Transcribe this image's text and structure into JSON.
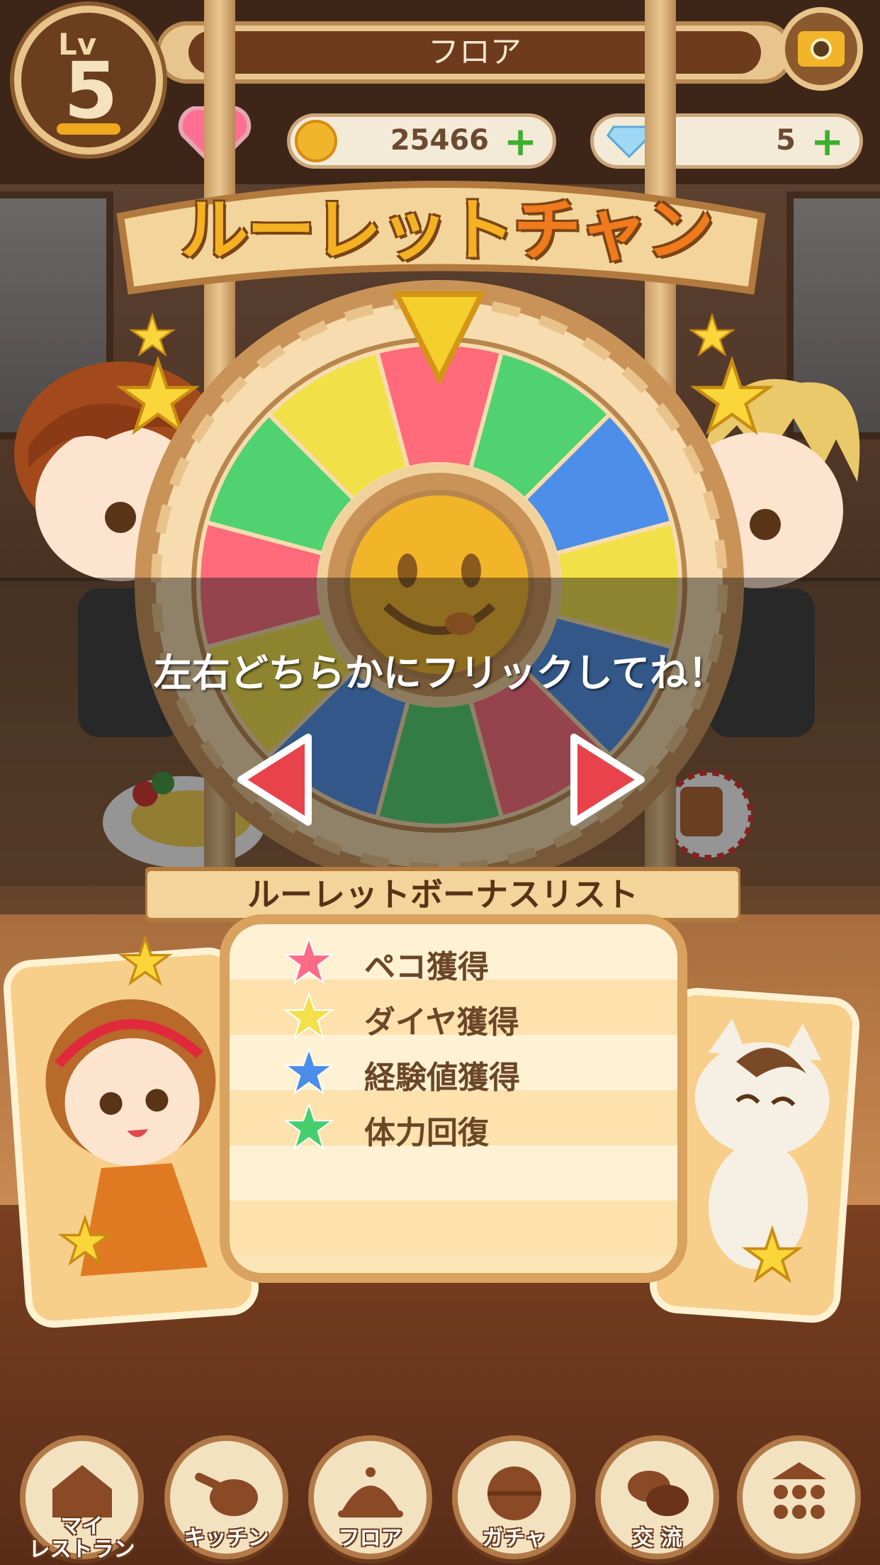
{
  "header": {
    "level_prefix": "Lv",
    "level": "5",
    "screen_title": "フロア",
    "coins": "25466",
    "gems": "5",
    "plus_symbol": "+"
  },
  "roulette": {
    "title_part1": "ルーレット",
    "title_part2": "チャンス",
    "instruction": "左右どちらかにフリックしてね！",
    "segment_colors": [
      "#ff6b7b",
      "#4fd26f",
      "#4d8ee8",
      "#f2e048"
    ]
  },
  "bonus_list": {
    "header": "ルーレットボーナスリスト",
    "items": [
      {
        "label": "ペコ獲得",
        "star_color": "#ff6b87"
      },
      {
        "label": "ダイヤ獲得",
        "star_color": "#f4e04a"
      },
      {
        "label": "経験値獲得",
        "star_color": "#4b8de8"
      },
      {
        "label": "体力回復",
        "star_color": "#45cf6c"
      }
    ]
  },
  "nav": {
    "my_restaurant_line1": "マイ",
    "my_restaurant_line2": "レストラン",
    "kitchen": "キッチン",
    "floor": "フロア",
    "gacha": "ガチャ",
    "exchange": "交 流"
  }
}
